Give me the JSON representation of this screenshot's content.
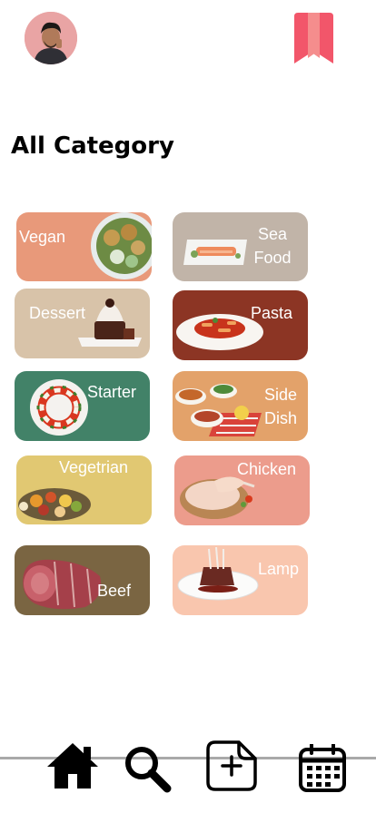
{
  "header": {
    "avatar_icon": "user-avatar",
    "bookmark_icon": "bookmark-icon",
    "bookmark_color": "#f2566a"
  },
  "page": {
    "title": "All Category"
  },
  "categories": [
    {
      "label": "Vegan",
      "color": "#e8997a"
    },
    {
      "label": "Sea Food",
      "label_lines": [
        "Sea",
        "Food"
      ],
      "color": "#c1b4a8"
    },
    {
      "label": "Dessert",
      "color": "#d8c3a9"
    },
    {
      "label": "Pasta",
      "color": "#8c3524"
    },
    {
      "label": "Starter",
      "color": "#428268"
    },
    {
      "label": "Side Dish",
      "label_lines": [
        "Side",
        "Dish"
      ],
      "color": "#e3a26a"
    },
    {
      "label": "Vegetrian",
      "color": "#e1c872"
    },
    {
      "label": "Chicken",
      "color": "#ec9c8c"
    },
    {
      "label": "Beef",
      "color": "#7a6542"
    },
    {
      "label": "Lamp",
      "color": "#f9c6ae"
    }
  ],
  "bottom_nav": [
    {
      "icon": "home-icon"
    },
    {
      "icon": "search-icon"
    },
    {
      "icon": "add-post-icon"
    },
    {
      "icon": "calendar-icon"
    }
  ]
}
